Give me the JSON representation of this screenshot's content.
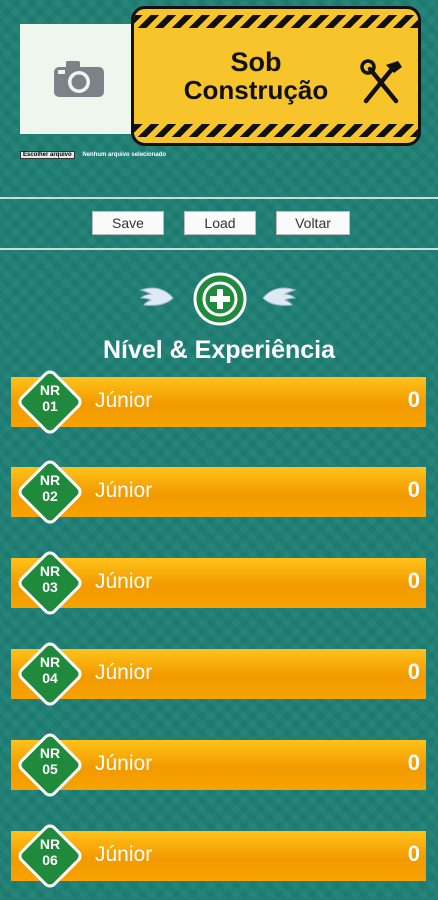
{
  "banner": {
    "line1": "Sob",
    "line2": "Construção"
  },
  "file_input": {
    "button_label": "Escolher arquivo",
    "status": "Nenhum arquivo selecionado"
  },
  "buttons": {
    "save": "Save",
    "load": "Load",
    "back": "Voltar"
  },
  "section_title": "Nível & Experiência",
  "rows": [
    {
      "code_top": "NR",
      "code_num": "01",
      "level": "Júnior",
      "value": "0"
    },
    {
      "code_top": "NR",
      "code_num": "02",
      "level": "Júnior",
      "value": "0"
    },
    {
      "code_top": "NR",
      "code_num": "03",
      "level": "Júnior",
      "value": "0"
    },
    {
      "code_top": "NR",
      "code_num": "04",
      "level": "Júnior",
      "value": "0"
    },
    {
      "code_top": "NR",
      "code_num": "05",
      "level": "Júnior",
      "value": "0"
    },
    {
      "code_top": "NR",
      "code_num": "06",
      "level": "Júnior",
      "value": "0"
    }
  ],
  "colors": {
    "background": "#1e7f74",
    "row_orange": "#f7a300",
    "badge_green": "#1f8a3c",
    "banner_yellow": "#f7c42c"
  },
  "icons": [
    "camera-icon",
    "tools-icon",
    "left-wing-icon",
    "add-icon",
    "right-wing-icon"
  ]
}
